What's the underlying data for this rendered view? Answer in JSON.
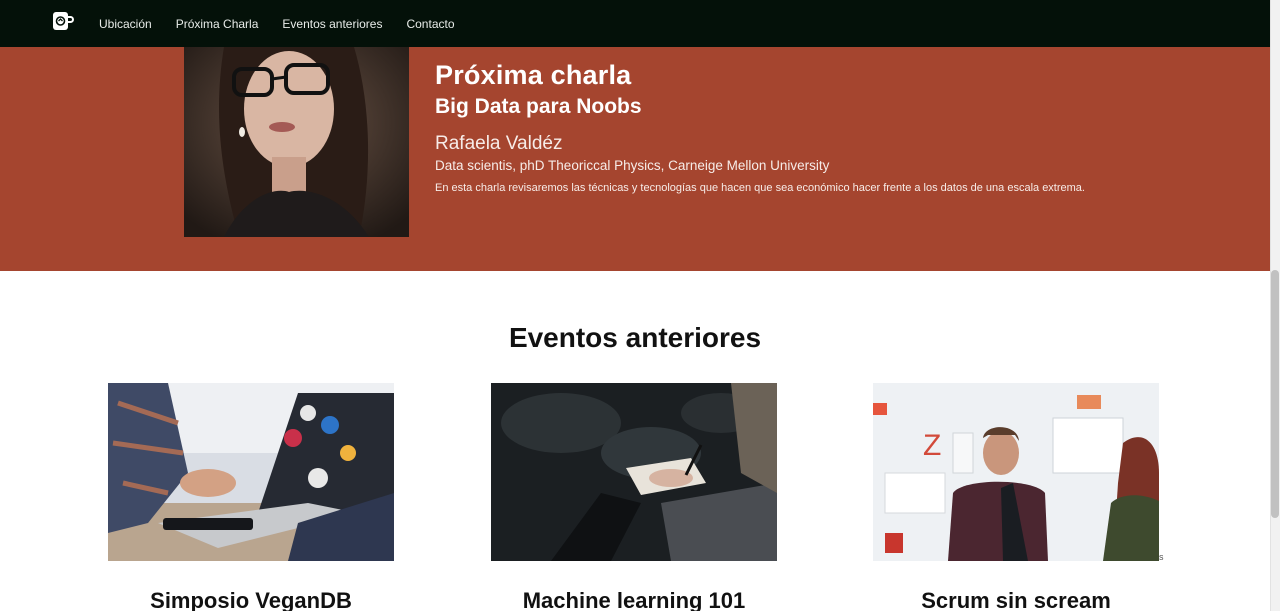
{
  "nav": {
    "logo_icon": "coffee-mug-logo-icon",
    "links": [
      "Ubicación",
      "Próxima Charla",
      "Eventos anteriores",
      "Contacto"
    ]
  },
  "hero": {
    "title": "Próxima charla",
    "subtitle": "Big Data para Noobs",
    "speaker_name": "Rafaela Valdéz",
    "speaker_role": "Data scientis, phD Theoriccal Physics, Carneige Mellon University",
    "description": "En esta charla revisaremos las técnicas y tecnologías que hacen que sea económico hacer frente a los datos de una escala extrema.",
    "colors": {
      "background": "#a5452f",
      "text": "#ffffff"
    }
  },
  "events": {
    "title": "Eventos anteriores",
    "cards": [
      {
        "title": "Simposio VeganDB",
        "image_icon": "laptop-with-stickers-photo"
      },
      {
        "title": "Machine learning 101",
        "image_icon": "audience-taking-notes-photo"
      },
      {
        "title": "Scrum sin scream",
        "image_icon": "people-at-whiteboard-photo"
      }
    ],
    "stray_text": "s"
  },
  "colors": {
    "navbar": "#041109",
    "accent": "#a5452f"
  }
}
